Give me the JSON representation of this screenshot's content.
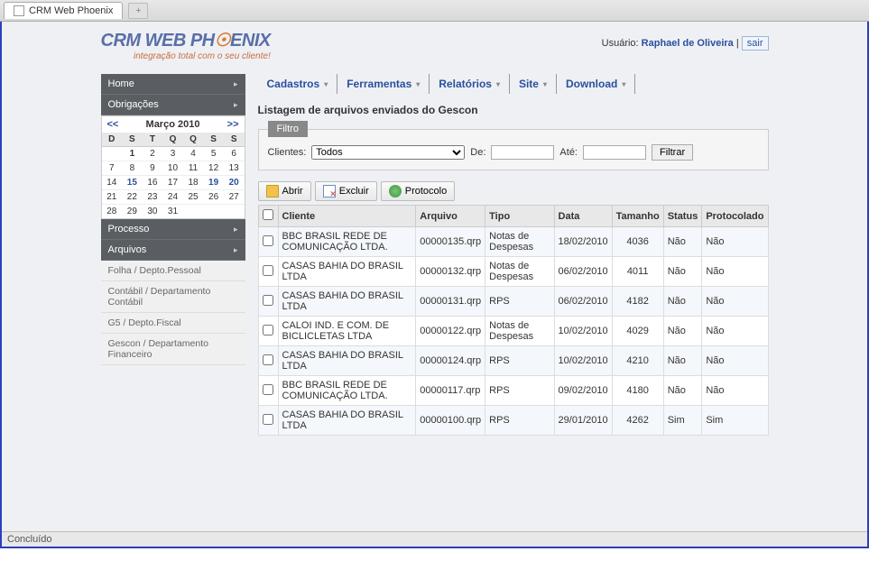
{
  "browser": {
    "tab_title": "CRM Web Phoenix",
    "status": "Concluído"
  },
  "logo": {
    "line1a": "CRM WEB PH",
    "line1b": "ENIX",
    "sub": "integração total com o seu cliente!"
  },
  "user": {
    "label": "Usuário:",
    "name": "Raphael de Oliveira",
    "logout": "sair"
  },
  "sidebar": {
    "top": [
      {
        "label": "Home"
      },
      {
        "label": "Obrigações"
      }
    ],
    "mid": [
      {
        "label": "Processo"
      },
      {
        "label": "Arquivos"
      }
    ],
    "sub": [
      {
        "label": "Folha / Depto.Pessoal"
      },
      {
        "label": "Contábil / Departamento Contábil"
      },
      {
        "label": "G5 / Depto.Fiscal"
      },
      {
        "label": "Gescon / Departamento Financeiro"
      }
    ]
  },
  "calendar": {
    "prev": "<<",
    "next": ">>",
    "title": "Março 2010",
    "dow": [
      "D",
      "S",
      "T",
      "Q",
      "Q",
      "S",
      "S"
    ],
    "rows": [
      [
        "",
        "1",
        "2",
        "3",
        "4",
        "5",
        "6"
      ],
      [
        "7",
        "8",
        "9",
        "10",
        "11",
        "12",
        "13"
      ],
      [
        "14",
        "15",
        "16",
        "17",
        "18",
        "19",
        "20"
      ],
      [
        "21",
        "22",
        "23",
        "24",
        "25",
        "26",
        "27"
      ],
      [
        "28",
        "29",
        "30",
        "31",
        "",
        "",
        ""
      ]
    ],
    "bold_cells": [
      "1"
    ],
    "blue_cells": [
      "15",
      "19",
      "20"
    ]
  },
  "menu": [
    {
      "label": "Cadastros"
    },
    {
      "label": "Ferramentas"
    },
    {
      "label": "Relatórios"
    },
    {
      "label": "Site"
    },
    {
      "label": "Download"
    }
  ],
  "page_title": "Listagem de arquivos enviados do Gescon",
  "filter": {
    "tab": "Filtro",
    "clientes_label": "Clientes:",
    "clientes_value": "Todos",
    "de_label": "De:",
    "ate_label": "Até:",
    "button": "Filtrar"
  },
  "actions": {
    "open": "Abrir",
    "delete": "Excluir",
    "protocol": "Protocolo"
  },
  "table": {
    "headers": [
      "",
      "Cliente",
      "Arquivo",
      "Tipo",
      "Data",
      "Tamanho",
      "Status",
      "Protocolado"
    ],
    "rows": [
      {
        "cliente": "BBC BRASIL REDE DE COMUNICAÇÃO LTDA.",
        "arquivo": "00000135.qrp",
        "tipo": "Notas de Despesas",
        "data": "18/02/2010",
        "tamanho": "4036",
        "status": "Não",
        "prot": "Não"
      },
      {
        "cliente": "CASAS BAHIA DO BRASIL LTDA",
        "arquivo": "00000132.qrp",
        "tipo": "Notas de Despesas",
        "data": "06/02/2010",
        "tamanho": "4011",
        "status": "Não",
        "prot": "Não"
      },
      {
        "cliente": "CASAS BAHIA DO BRASIL LTDA",
        "arquivo": "00000131.qrp",
        "tipo": "RPS",
        "data": "06/02/2010",
        "tamanho": "4182",
        "status": "Não",
        "prot": "Não"
      },
      {
        "cliente": "CALOI IND. E COM. DE BICLICLETAS LTDA",
        "arquivo": "00000122.qrp",
        "tipo": "Notas de Despesas",
        "data": "10/02/2010",
        "tamanho": "4029",
        "status": "Não",
        "prot": "Não"
      },
      {
        "cliente": "CASAS BAHIA DO BRASIL LTDA",
        "arquivo": "00000124.qrp",
        "tipo": "RPS",
        "data": "10/02/2010",
        "tamanho": "4210",
        "status": "Não",
        "prot": "Não"
      },
      {
        "cliente": "BBC BRASIL REDE DE COMUNICAÇÃO LTDA.",
        "arquivo": "00000117.qrp",
        "tipo": "RPS",
        "data": "09/02/2010",
        "tamanho": "4180",
        "status": "Não",
        "prot": "Não"
      },
      {
        "cliente": "CASAS BAHIA DO BRASIL LTDA",
        "arquivo": "00000100.qrp",
        "tipo": "RPS",
        "data": "29/01/2010",
        "tamanho": "4262",
        "status": "Sim",
        "prot": "Sim"
      }
    ]
  }
}
